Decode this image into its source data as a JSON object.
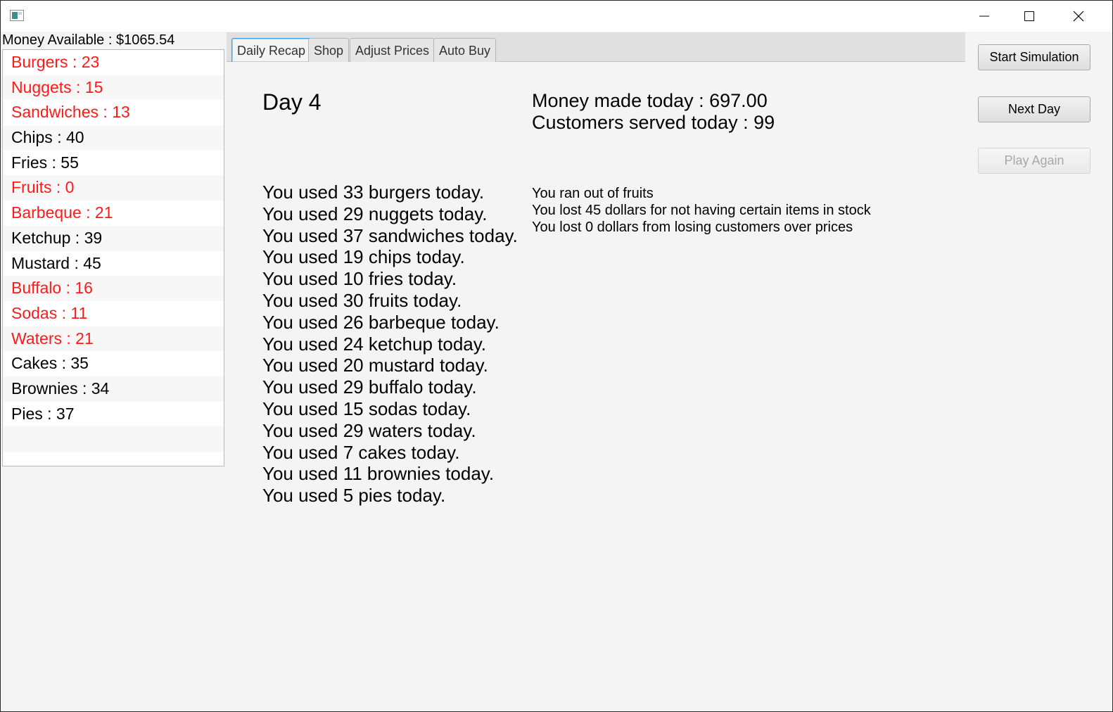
{
  "window": {
    "controls": {
      "minimize_icon": "minimize-icon",
      "maximize_icon": "maximize-icon",
      "close_icon": "close-icon"
    }
  },
  "money": {
    "label": "Money Available : $1065.54"
  },
  "inventory": [
    {
      "label": "Burgers : 23",
      "low": true
    },
    {
      "label": "Nuggets : 15",
      "low": true
    },
    {
      "label": "Sandwiches : 13",
      "low": true
    },
    {
      "label": "Chips : 40",
      "low": false
    },
    {
      "label": "Fries : 55",
      "low": false
    },
    {
      "label": "Fruits : 0",
      "low": true
    },
    {
      "label": "Barbeque : 21",
      "low": true
    },
    {
      "label": "Ketchup : 39",
      "low": false
    },
    {
      "label": "Mustard : 45",
      "low": false
    },
    {
      "label": "Buffalo : 16",
      "low": true
    },
    {
      "label": "Sodas : 11",
      "low": true
    },
    {
      "label": "Waters : 21",
      "low": true
    },
    {
      "label": "Cakes : 35",
      "low": false
    },
    {
      "label": "Brownies : 34",
      "low": false
    },
    {
      "label": "Pies : 37",
      "low": false
    }
  ],
  "tabs": [
    {
      "label": "Daily Recap",
      "active": true
    },
    {
      "label": "Shop",
      "active": false
    },
    {
      "label": "Adjust Prices",
      "active": false
    },
    {
      "label": "Auto Buy",
      "active": false
    }
  ],
  "recap": {
    "day_title": "Day 4",
    "money_made": "Money made today : 697.00",
    "customers_served": "Customers served today : 99",
    "usage": [
      "You used 33 burgers today.",
      "You used 29 nuggets today.",
      "You used 37 sandwiches today.",
      "You used 19 chips today.",
      "You used 10 fries today.",
      "You used 30 fruits today.",
      "You used 26 barbeque today.",
      "You used 24 ketchup today.",
      "You used 20 mustard today.",
      "You used 29 buffalo today.",
      "You used 15 sodas today.",
      "You used 29 waters today.",
      "You used 7 cakes today.",
      "You used 11 brownies today.",
      "You used 5 pies today."
    ],
    "notes": [
      "You ran out of fruits",
      "You lost 45 dollars for not having certain items in stock",
      "You lost 0 dollars from losing customers over prices"
    ]
  },
  "buttons": {
    "start_simulation": "Start Simulation",
    "next_day": "Next Day",
    "play_again": "Play Again"
  },
  "colors": {
    "low_stock": "#ff1a1a",
    "active_tab_border": "#3b9ee8"
  }
}
